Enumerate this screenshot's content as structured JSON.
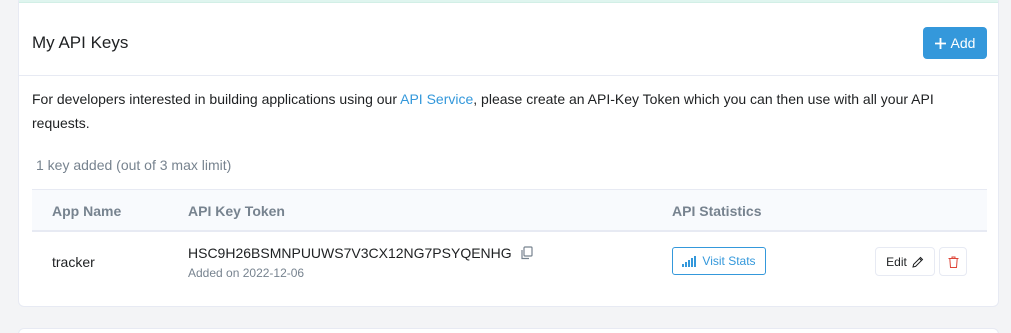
{
  "header": {
    "title": "My API Keys",
    "add_label": "Add"
  },
  "description": {
    "before": "For developers interested in building applications using our ",
    "link": "API Service",
    "after": ", please create an API-Key Token which you can then use with all your API requests."
  },
  "key_count": "1 key added (out of 3 max limit)",
  "table": {
    "columns": [
      "App Name",
      "API Key Token",
      "API Statistics"
    ],
    "rows": [
      {
        "app_name": "tracker",
        "token": "HSC9H26BSMNPUUWS7V3CX12NG7PSYQENHG",
        "added": "Added on 2022-12-06",
        "stats_label": "Visit Stats",
        "edit_label": "Edit"
      }
    ]
  },
  "colors": {
    "accent": "#3498db",
    "danger": "#de4437",
    "muted": "#77838f"
  },
  "icons": [
    "plus-icon",
    "copy-icon",
    "bar-chart-icon",
    "pencil-icon",
    "trash-icon"
  ]
}
